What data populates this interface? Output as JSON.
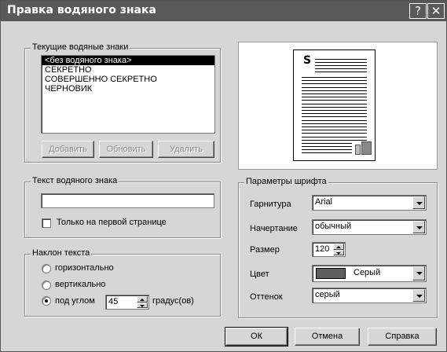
{
  "window": {
    "title": "Правка водяного знака",
    "help_glyph": "?",
    "close_glyph": "✕"
  },
  "current_watermarks": {
    "legend": "Текущие водяные знаки",
    "items": [
      "<без водяного знака>",
      "СЕКРЕТНО",
      "СОВЕРШЕННО СЕКРЕТНО",
      "ЧЕРНОВИК"
    ],
    "selected_index": 0,
    "add_label": "Добавить",
    "update_label": "Обновить",
    "delete_label": "Удалить"
  },
  "preview": {
    "letter": "S"
  },
  "watermark_text": {
    "legend": "Текст водяного знака",
    "value": "",
    "first_page_only_label": "Только на первой странице",
    "first_page_only_checked": false
  },
  "text_angle": {
    "legend": "Наклон текста",
    "horizontal_label": "горизонтально",
    "vertical_label": "вертикально",
    "angle_label": "под углом",
    "angle_value": "45",
    "units_label": "градус(ов)",
    "selected": "angle"
  },
  "font_params": {
    "legend": "Параметры шрифта",
    "typeface_label": "Гарнитура",
    "typeface_value": "Arial",
    "style_label": "Начертание",
    "style_value": "обычный",
    "size_label": "Размер",
    "size_value": "120",
    "color_label": "Цвет",
    "color_value": "Серый",
    "color_swatch": "#5f5f5f",
    "shade_label": "Оттенок",
    "shade_value": "серый"
  },
  "footer": {
    "ok_label": "ОК",
    "cancel_label": "Отмена",
    "help_label": "Справка"
  }
}
